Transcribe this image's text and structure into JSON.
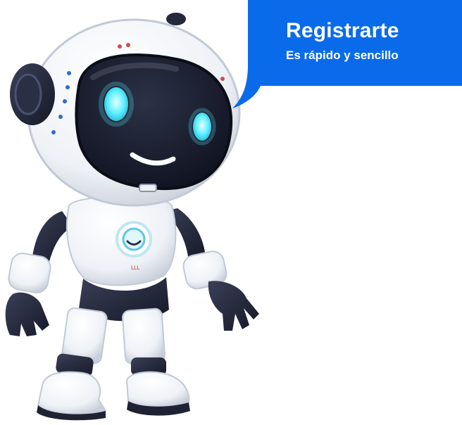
{
  "bubble": {
    "title": "Registrarte",
    "subtitle": "Es rápido y sencillo"
  },
  "colors": {
    "bubble_background": "#0a6bea",
    "bubble_text": "#ffffff",
    "robot_shell": "#f2f4f7",
    "robot_dark": "#1e2233",
    "robot_eye_glow": "#5ff0ff"
  },
  "icons": {
    "mascot": "robot-mascot-illustration",
    "chest_emblem": "smiley-emblem-icon"
  }
}
